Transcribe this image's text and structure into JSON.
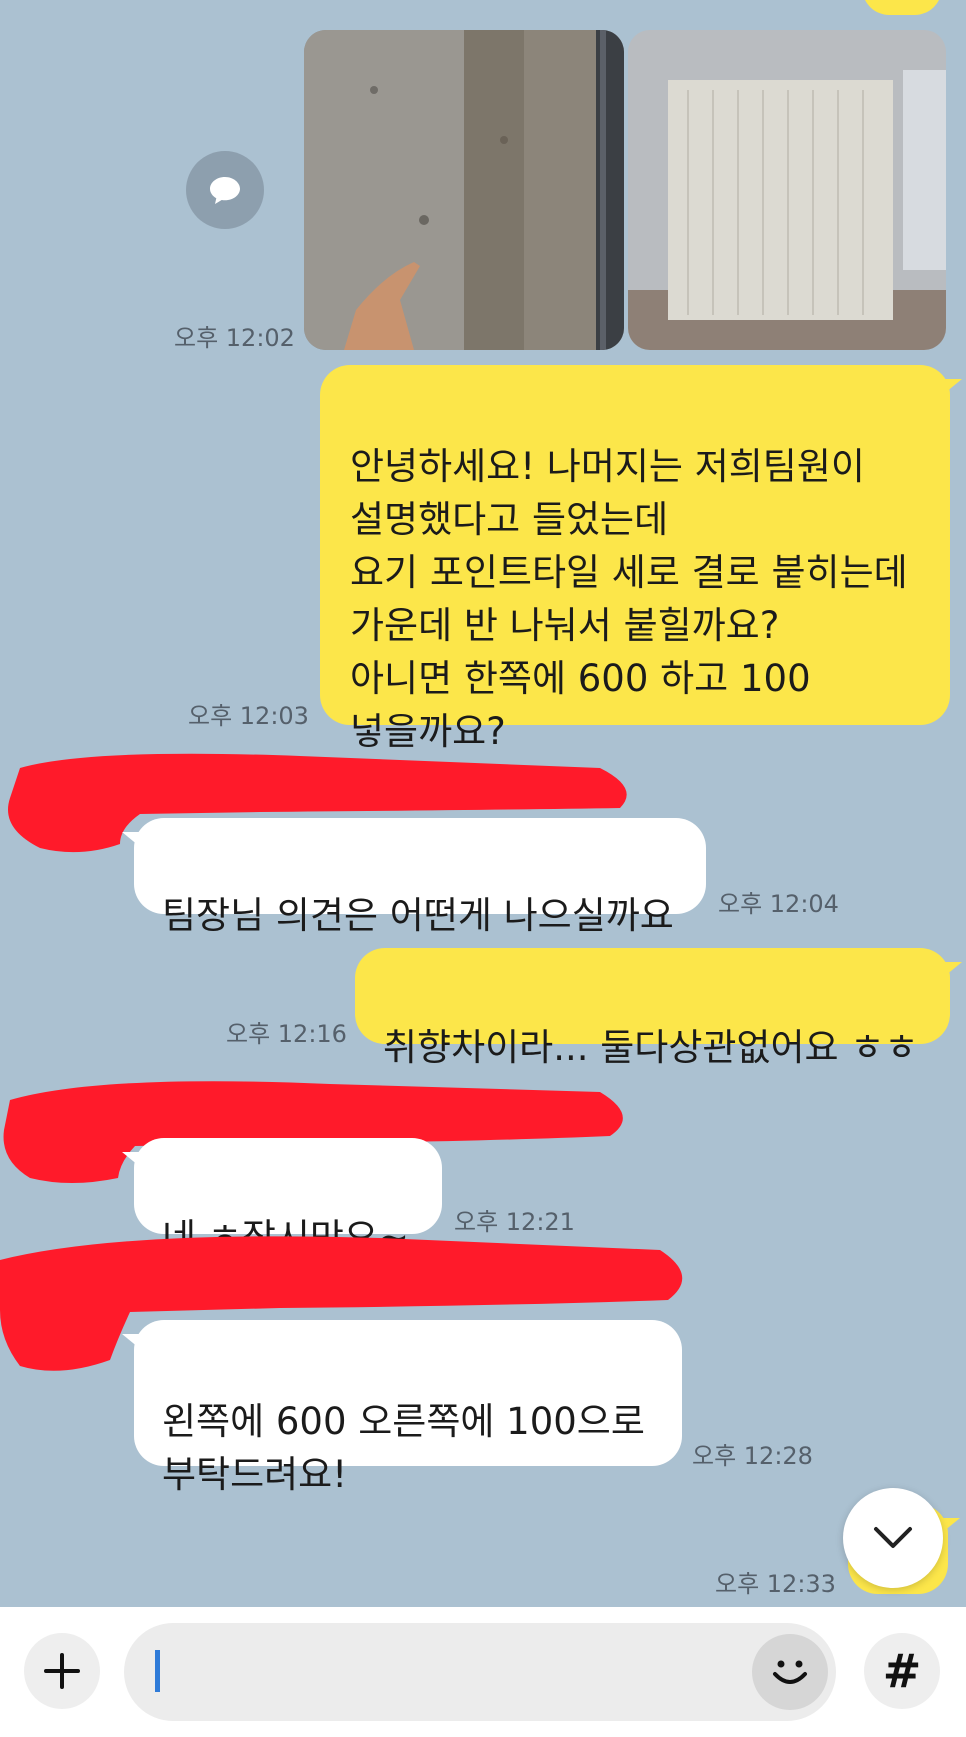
{
  "messages": {
    "photos_time": "오후 12:02",
    "m1": {
      "text": "안녕하세요! 나머지는 저희팀원이\n설명했다고 들었는데\n요기 포인트타일 세로 결로 붙히는데\n가운데 반 나눠서 붙힐까요?\n아니면 한쪽에 600 하고 100\n넣을까요?",
      "time": "오후 12:03"
    },
    "m2": {
      "text": "팀장님 의견은 어떤게 나으실까요",
      "time": "오후 12:04"
    },
    "m3": {
      "text": "취향차이라... 둘다상관없어요 ㅎㅎ",
      "time": "오후 12:16"
    },
    "m4": {
      "text": "네 ㅎ잠시만요~",
      "time": "오후 12:21"
    },
    "m5": {
      "text": "왼쪽에 600 오른쪽에 100으로\n부탁드려요!",
      "time": "오후 12:28"
    },
    "m6": {
      "time": "오후 12:33"
    }
  },
  "icons": {
    "share": "speech-bubble-icon",
    "scroll": "chevron-down-icon",
    "attach": "plus-icon",
    "emoji": "emoji-icon",
    "hash": "hash-icon"
  },
  "input": {
    "hash_label": "#"
  },
  "colors": {
    "background": "#abc1d1",
    "my_bubble": "#fce64a",
    "their_bubble": "#ffffff",
    "redaction": "#ff1a2a"
  }
}
